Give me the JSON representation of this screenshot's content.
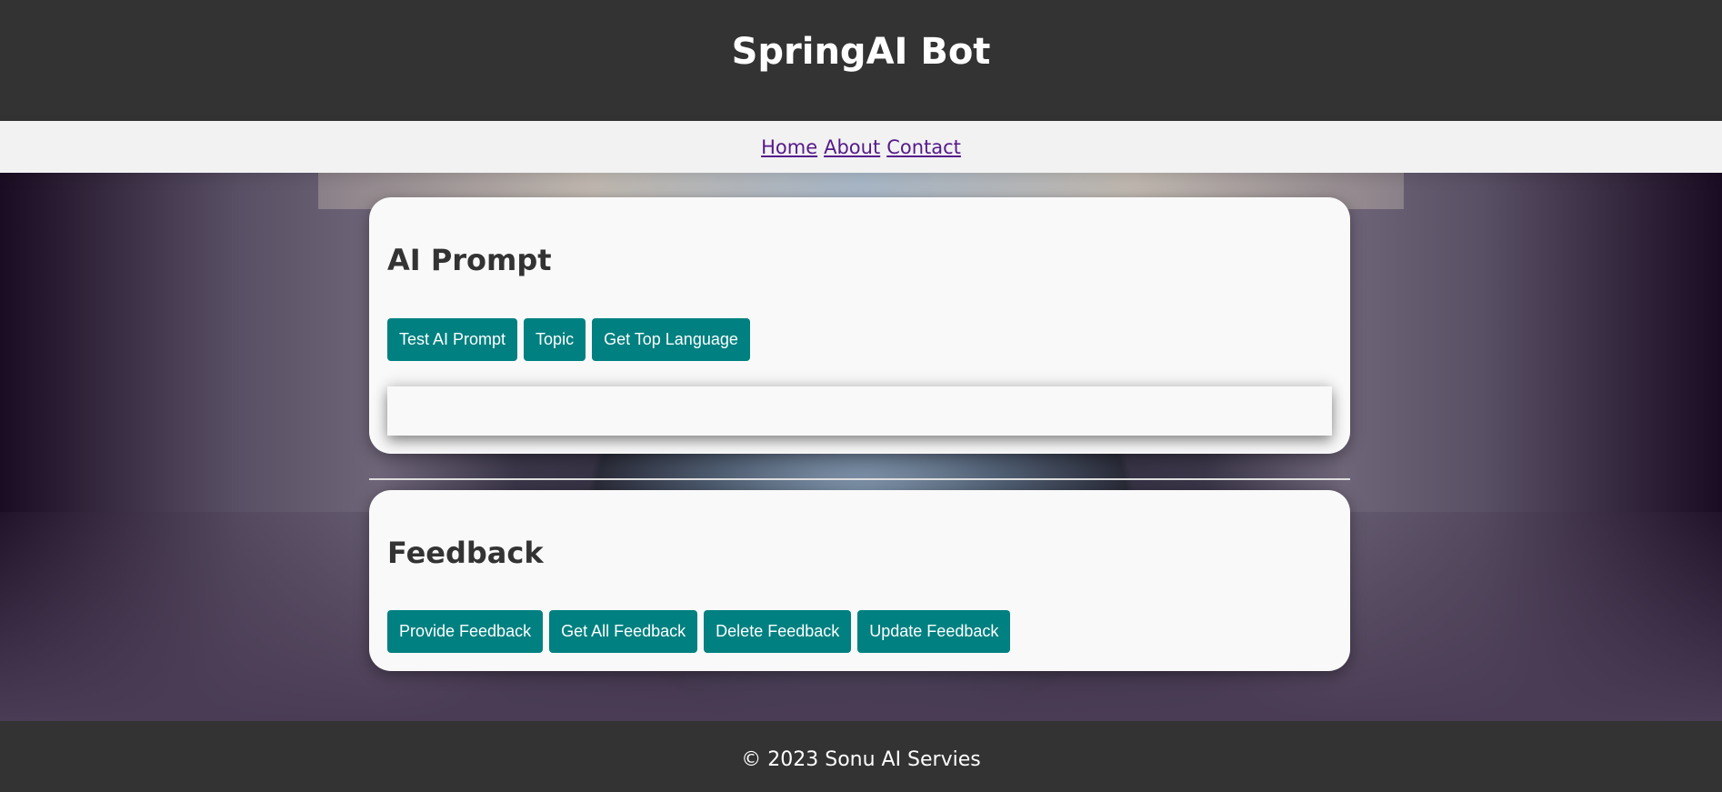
{
  "header": {
    "title": "SpringAI Bot"
  },
  "nav": {
    "links": [
      {
        "label": "Home"
      },
      {
        "label": "About"
      },
      {
        "label": "Contact"
      }
    ]
  },
  "ai_prompt": {
    "title": "AI Prompt",
    "buttons": [
      {
        "label": "Test AI Prompt"
      },
      {
        "label": "Topic"
      },
      {
        "label": "Get Top Language"
      }
    ],
    "output": ""
  },
  "feedback": {
    "title": "Feedback",
    "buttons": [
      {
        "label": "Provide Feedback"
      },
      {
        "label": "Get All Feedback"
      },
      {
        "label": "Delete Feedback"
      },
      {
        "label": "Update Feedback"
      }
    ]
  },
  "footer": {
    "text": "© 2023 Sonu AI Servies"
  },
  "colors": {
    "header_bg": "#333333",
    "nav_bg": "#f2f2f2",
    "button_bg": "#008080",
    "link": "#551a8b",
    "card_bg": "#f9f9f9"
  }
}
